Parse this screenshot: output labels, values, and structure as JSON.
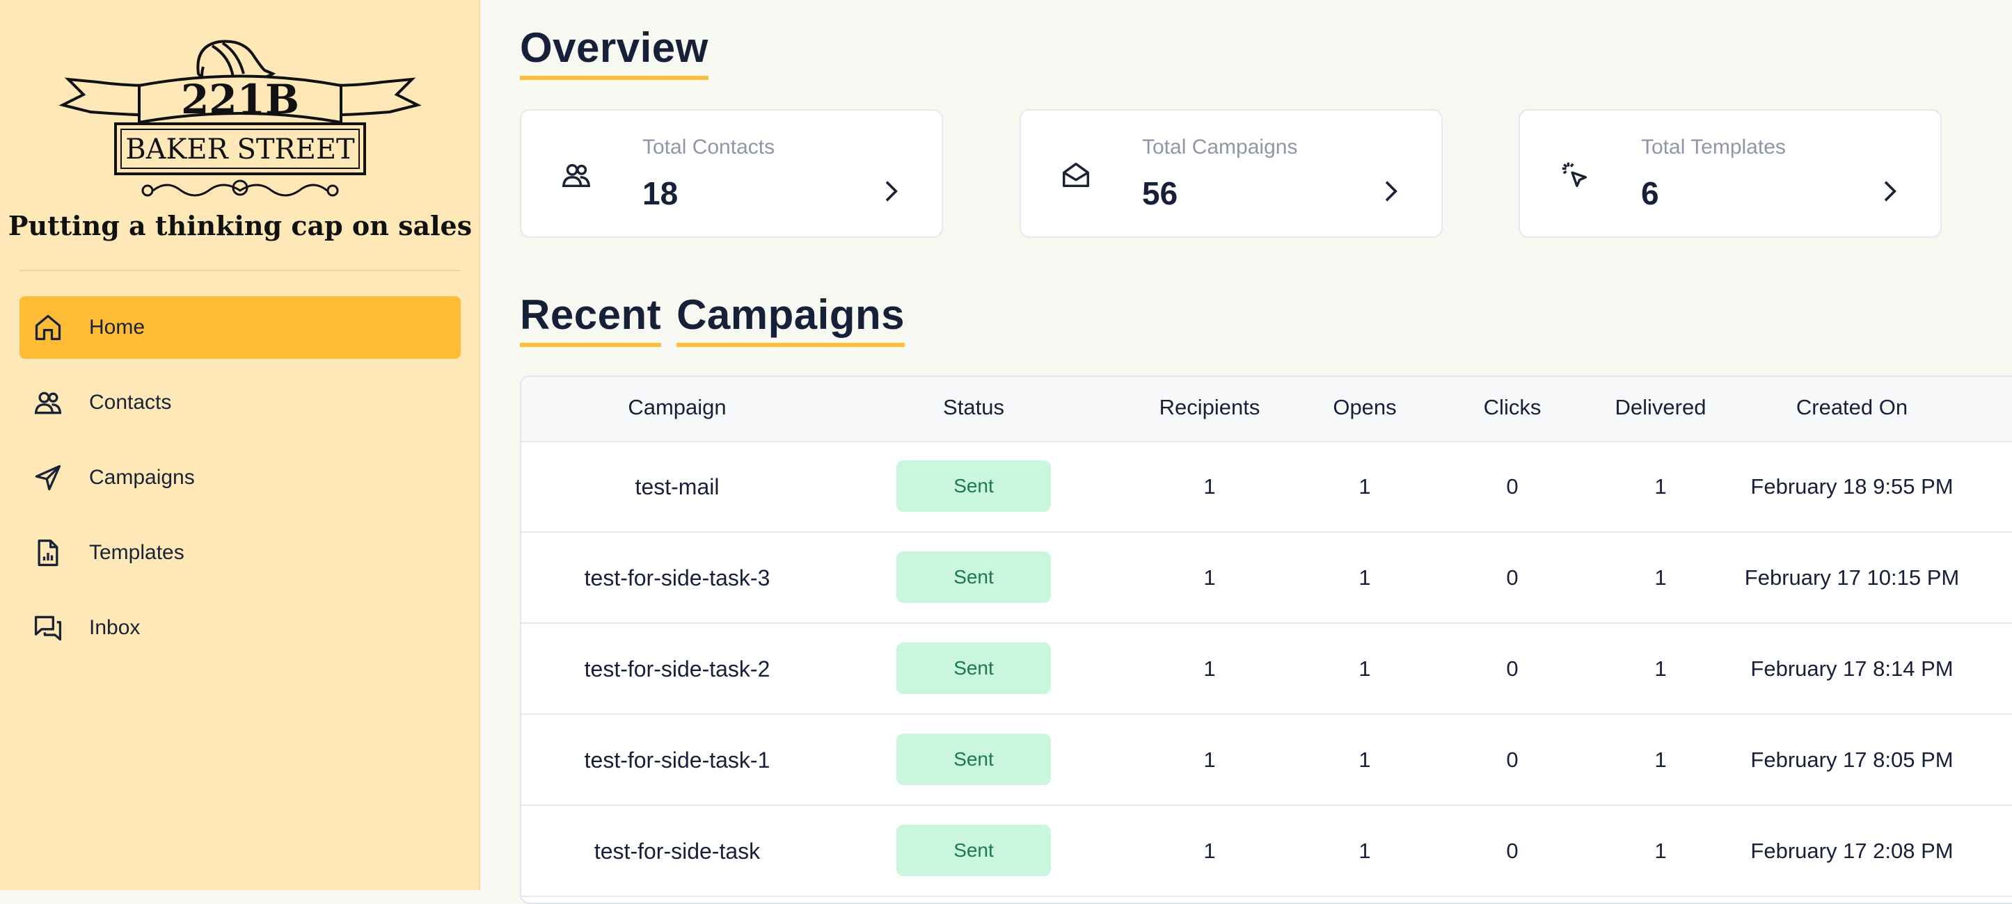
{
  "brand": {
    "number": "221B",
    "street": "BAKER STREET",
    "tagline": "Putting a thinking cap on sales"
  },
  "sidebar": {
    "items": [
      {
        "label": "Home",
        "icon": "home-icon",
        "active": true
      },
      {
        "label": "Contacts",
        "icon": "users-icon",
        "active": false
      },
      {
        "label": "Campaigns",
        "icon": "send-icon",
        "active": false
      },
      {
        "label": "Templates",
        "icon": "file-chart-icon",
        "active": false
      },
      {
        "label": "Inbox",
        "icon": "chat-icon",
        "active": false
      }
    ]
  },
  "overview": {
    "title": "Overview",
    "cards": [
      {
        "label": "Total Contacts",
        "value": "18",
        "icon": "users-icon"
      },
      {
        "label": "Total Campaigns",
        "value": "56",
        "icon": "mail-open-icon"
      },
      {
        "label": "Total Templates",
        "value": "6",
        "icon": "cursor-click-icon"
      }
    ]
  },
  "recent": {
    "title_words": [
      "Recent",
      "Campaigns"
    ],
    "columns": [
      "Campaign",
      "Status",
      "Recipients",
      "Opens",
      "Clicks",
      "Delivered",
      "Created On"
    ],
    "rows": [
      {
        "campaign": "test-mail",
        "status": "Sent",
        "recipients": "1",
        "opens": "1",
        "clicks": "0",
        "delivered": "1",
        "created": "February 18 9:55 PM"
      },
      {
        "campaign": "test-for-side-task-3",
        "status": "Sent",
        "recipients": "1",
        "opens": "1",
        "clicks": "0",
        "delivered": "1",
        "created": "February 17 10:15 PM"
      },
      {
        "campaign": "test-for-side-task-2",
        "status": "Sent",
        "recipients": "1",
        "opens": "1",
        "clicks": "0",
        "delivered": "1",
        "created": "February 17 8:14 PM"
      },
      {
        "campaign": "test-for-side-task-1",
        "status": "Sent",
        "recipients": "1",
        "opens": "1",
        "clicks": "0",
        "delivered": "1",
        "created": "February 17 8:05 PM"
      },
      {
        "campaign": "test-for-side-task",
        "status": "Sent",
        "recipients": "1",
        "opens": "1",
        "clicks": "0",
        "delivered": "1",
        "created": "February 17 2:08 PM"
      }
    ]
  },
  "colors": {
    "sidebar_bg": "#fee8b8",
    "accent": "#ffbc37",
    "badge_bg": "#c9f6dc",
    "badge_text": "#1c7a49"
  }
}
